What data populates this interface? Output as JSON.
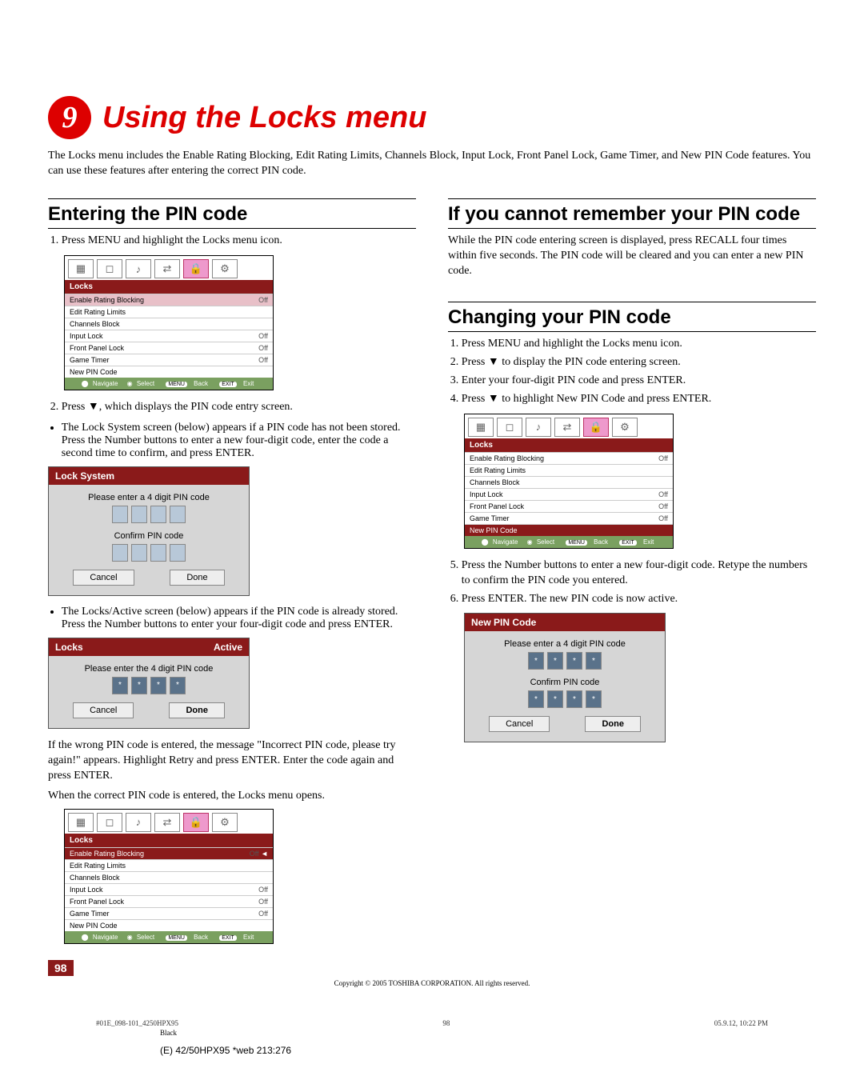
{
  "chapter": {
    "number": "9",
    "title": "Using the Locks menu"
  },
  "intro": "The Locks menu includes the Enable Rating Blocking, Edit Rating Limits, Channels Block, Input Lock, Front Panel Lock, Game Timer, and New PIN Code features. You can use these features after entering the correct PIN code.",
  "left": {
    "h1": "Entering the PIN code",
    "step1": "Press MENU and highlight the Locks menu icon.",
    "step2": "Press ▼, which displays the PIN code entry screen.",
    "bullet1": "The Lock System screen (below) appears if a PIN code has not been stored. Press the Number buttons to enter a new four-digit code, enter the code a second time to confirm, and press ENTER.",
    "bullet2": "The Locks/Active screen (below) appears if the PIN code is already stored. Press the Number buttons to enter your four-digit code and press ENTER.",
    "wrongpin": "If the wrong PIN code is entered, the message \"Incorrect PIN code, please try again!\" appears. Highlight Retry and press ENTER. Enter the code again and press ENTER.",
    "correctpin": "When the correct PIN code is entered, the Locks menu opens."
  },
  "right": {
    "h1": "If you cannot remember your PIN code",
    "forgot": "While the PIN code entering screen is displayed, press RECALL four times within five seconds. The PIN code will be cleared and you can enter a new PIN code.",
    "h2": "Changing your PIN code",
    "step1": "Press MENU and highlight the Locks menu icon.",
    "step2": "Press ▼ to display the PIN code entering screen.",
    "step3": "Enter your four-digit PIN code and press ENTER.",
    "step4": "Press ▼ to highlight New PIN Code and press ENTER.",
    "step5": "Press the Number buttons to enter a new four-digit code. Retype the numbers to confirm the PIN code you entered.",
    "step6": "Press ENTER. The new PIN code is now active."
  },
  "osd": {
    "title": "Locks",
    "rows": [
      {
        "label": "Enable Rating Blocking",
        "value": "Off"
      },
      {
        "label": "Edit Rating Limits",
        "value": ""
      },
      {
        "label": "Channels Block",
        "value": ""
      },
      {
        "label": "Input Lock",
        "value": "Off"
      },
      {
        "label": "Front Panel Lock",
        "value": "Off"
      },
      {
        "label": "Game Timer",
        "value": "Off"
      },
      {
        "label": "New PIN Code",
        "value": ""
      }
    ],
    "footer": {
      "nav": "Navigate",
      "sel": "Select",
      "back": "Back",
      "exit": "Exit",
      "backBadge": "MENU",
      "exitBadge": "EXIT"
    }
  },
  "osd_selected_row1": {
    "label": "Enable Rating Blocking",
    "value": "Off",
    "arrow": "◄"
  },
  "lockSystem": {
    "title": "Lock System",
    "prompt1": "Please enter a 4 digit PIN code",
    "prompt2": "Confirm PIN code",
    "cancel": "Cancel",
    "done": "Done"
  },
  "locksActive": {
    "title": "Locks",
    "status": "Active",
    "prompt": "Please enter the 4 digit PIN code",
    "cancel": "Cancel",
    "done": "Done"
  },
  "newPinCode": {
    "title": "New PIN Code",
    "prompt1": "Please enter a 4 digit PIN code",
    "prompt2": "Confirm PIN code",
    "cancel": "Cancel",
    "done": "Done"
  },
  "pagenum": "98",
  "copyright": "Copyright © 2005 TOSHIBA CORPORATION. All rights reserved.",
  "footer": {
    "left": "#01E_098-101_4250HPX95",
    "center": "98",
    "right": "05.9.12, 10:22 PM",
    "black": "Black"
  },
  "model": "(E) 42/50HPX95 *web 213:276"
}
